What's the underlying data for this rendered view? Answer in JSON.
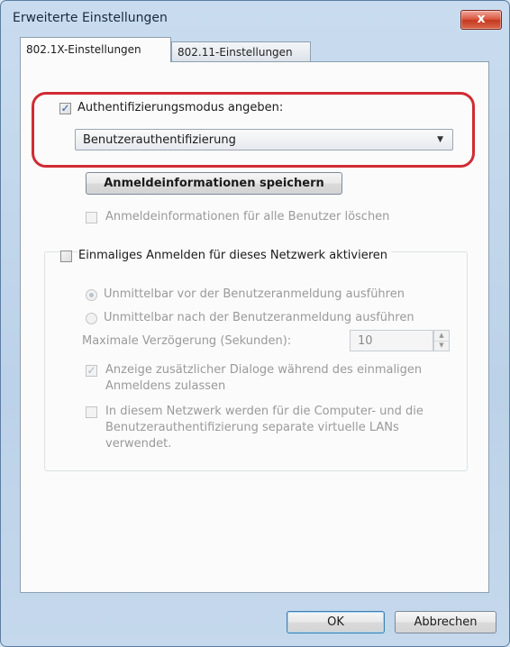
{
  "window": {
    "title": "Erweiterte Einstellungen",
    "close_label": "x"
  },
  "tabs": [
    {
      "label": "802.1X-Einstellungen",
      "active": true
    },
    {
      "label": "802.11-Einstellungen",
      "active": false
    }
  ],
  "auth": {
    "checkbox_label": "Authentifizierungsmodus angeben:",
    "checked": true,
    "mode_value": "Benutzerauthentifizierung",
    "save_credentials_label": "Anmeldeinformationen speichern",
    "delete_credentials_label": "Anmeldeinformationen für alle Benutzer löschen",
    "delete_credentials_checked": false
  },
  "sso": {
    "checkbox_label": "Einmaliges Anmelden für dieses Netzwerk aktivieren",
    "checked": false,
    "radio_before_label": "Unmittelbar vor der Benutzeranmeldung ausführen",
    "radio_before_selected": true,
    "radio_after_label": "Unmittelbar nach der Benutzeranmeldung ausführen",
    "radio_after_selected": false,
    "max_delay_label": "Maximale Verzögerung (Sekunden):",
    "max_delay_value": "10",
    "dialogs_label_line1": "Anzeige zusätzlicher Dialoge während des einmaligen",
    "dialogs_label_line2": "Anmeldens zulassen",
    "dialogs_checked": true,
    "vlan_label_line1": "In diesem Netzwerk werden für die Computer- und die",
    "vlan_label_line2": "Benutzerauthentifizierung separate virtuelle LANs",
    "vlan_label_line3": "verwendet.",
    "vlan_checked": false
  },
  "footer": {
    "ok_label": "OK",
    "cancel_label": "Abbrechen"
  },
  "colors": {
    "highlight": "#d12b34",
    "window_frame": "#c9dcef",
    "check_mark": "#2b5ea8"
  }
}
